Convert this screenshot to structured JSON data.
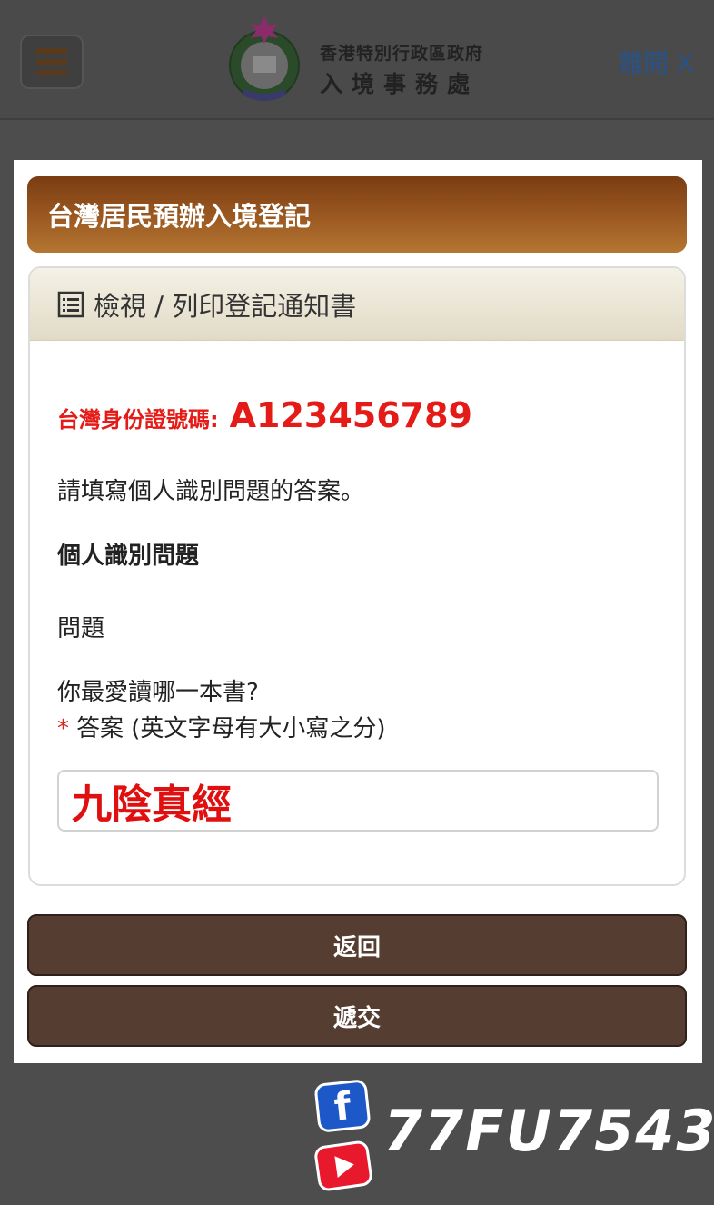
{
  "header": {
    "org_line1": "香港特別行政區政府",
    "org_line2": "入境事務處",
    "leave_label": "離開 X",
    "menu_icon": "hamburger-icon",
    "logo_icon": "immigration-emblem-icon"
  },
  "page": {
    "title": "台灣居民預辦入境登記"
  },
  "card": {
    "heading": "檢視 / 列印登記通知書",
    "heading_icon": "list-icon",
    "id_label": "台灣身份證號碼:",
    "id_value": "A123456789",
    "instruction": "請填寫個人識別問題的答案。",
    "section_title": "個人識別問題",
    "question_label": "問題",
    "question_text": "你最愛讀哪一本書?",
    "required_mark": "*",
    "answer_label": "答案 (英文字母有大小寫之分)",
    "answer_value": "九陰真經"
  },
  "buttons": {
    "back": "返回",
    "submit": "遞交"
  },
  "watermark": {
    "fb_glyph": "f",
    "handle": "77FU7543"
  },
  "colors": {
    "title_bar": "#9c5a22",
    "button": "#553d31",
    "id_red": "#e41b17",
    "link_blue": "#27538a"
  }
}
